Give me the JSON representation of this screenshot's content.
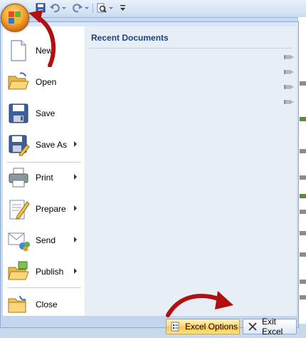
{
  "quick_access": {
    "icons": [
      "office-button-icon",
      "save-icon",
      "undo-icon",
      "redo-icon",
      "print-preview-icon",
      "customize-icon"
    ]
  },
  "menu": {
    "items": [
      {
        "label": "New",
        "icon": "new-document-icon",
        "has_arrow": false
      },
      {
        "label": "Open",
        "icon": "open-folder-icon",
        "has_arrow": false
      },
      {
        "label": "Save",
        "icon": "save-icon",
        "has_arrow": false
      },
      {
        "label": "Save As",
        "icon": "save-as-icon",
        "has_arrow": true
      },
      {
        "label": "Print",
        "icon": "printer-icon",
        "has_arrow": true
      },
      {
        "label": "Prepare",
        "icon": "prepare-icon",
        "has_arrow": true
      },
      {
        "label": "Send",
        "icon": "send-icon",
        "has_arrow": true
      },
      {
        "label": "Publish",
        "icon": "publish-icon",
        "has_arrow": true
      },
      {
        "label": "Close",
        "icon": "close-folder-icon",
        "has_arrow": false
      }
    ]
  },
  "recent": {
    "title": "Recent Documents",
    "pin_count": 4
  },
  "bottom": {
    "options_label": "Excel Options",
    "exit_label": "Exit Excel"
  },
  "colors": {
    "accent_title": "#15428b",
    "annotation": "#b01010",
    "options_highlight": "#ffd777"
  }
}
